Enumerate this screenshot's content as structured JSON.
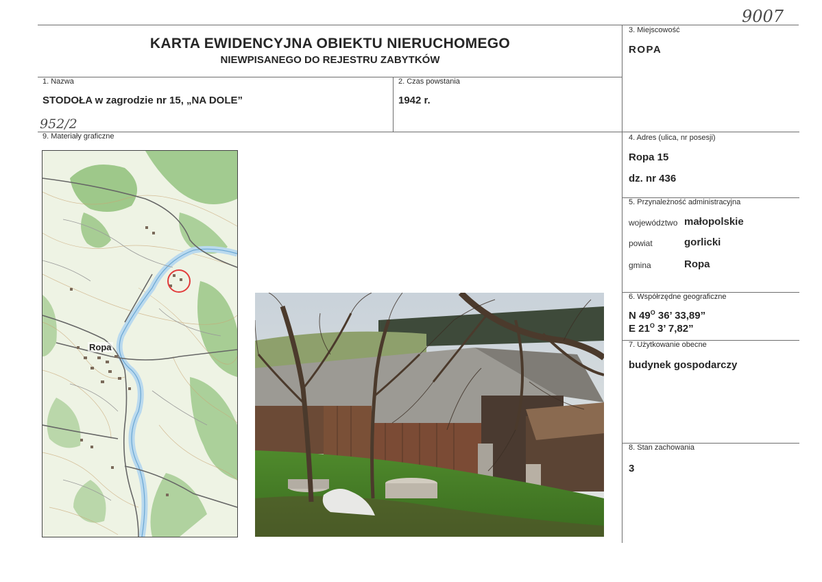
{
  "handwritten": {
    "catalog_number": "9007",
    "map_ref": "952/2"
  },
  "header": {
    "title_line1": "KARTA EWIDENCYJNA OBIEKTU NIERUCHOMEGO",
    "title_line2": "NIEWPISANEGO DO REJESTRU ZABYTKÓW"
  },
  "fields": {
    "nazwa": {
      "label": "1. Nazwa",
      "value": "STODOŁA w zagrodzie nr 15, „NA DOLE”"
    },
    "czas": {
      "label": "2. Czas powstania",
      "value": "1942 r."
    },
    "miejscowosc": {
      "label": "3. Miejscowość",
      "value": "ROPA"
    },
    "adres": {
      "label": "4. Adres (ulica, nr posesji)",
      "line1": "Ropa 15",
      "line2": "dz. nr 436"
    },
    "przynaleznosc": {
      "label": "5. Przynależność administracyjna",
      "rows": [
        {
          "label": "województwo",
          "value": "małopolskie"
        },
        {
          "label": "powiat",
          "value": "gorlicki"
        },
        {
          "label": "gmina",
          "value": "Ropa"
        }
      ]
    },
    "wspolrzedne": {
      "label": "6. Współrzędne geograficzne",
      "n_prefix": "N 49",
      "n_deg": "O",
      "n_rest": " 36’ 33,89”",
      "e_prefix": "E 21",
      "e_deg": "O",
      "e_rest": " 3’ 7,82”"
    },
    "uzytkowanie": {
      "label": "7. Użytkowanie obecne",
      "value": "budynek gospodarczy"
    },
    "stan": {
      "label": "8. Stan zachowania",
      "value": "3"
    },
    "materialy": {
      "label": "9. Materiały graficzne"
    }
  },
  "map": {
    "place_label": "Ropa",
    "colors": {
      "paper": "#eef3e4",
      "forest": "#8fc07a",
      "river": "#b9d9ee",
      "road": "#666666",
      "marker": "#e23b3b"
    }
  }
}
